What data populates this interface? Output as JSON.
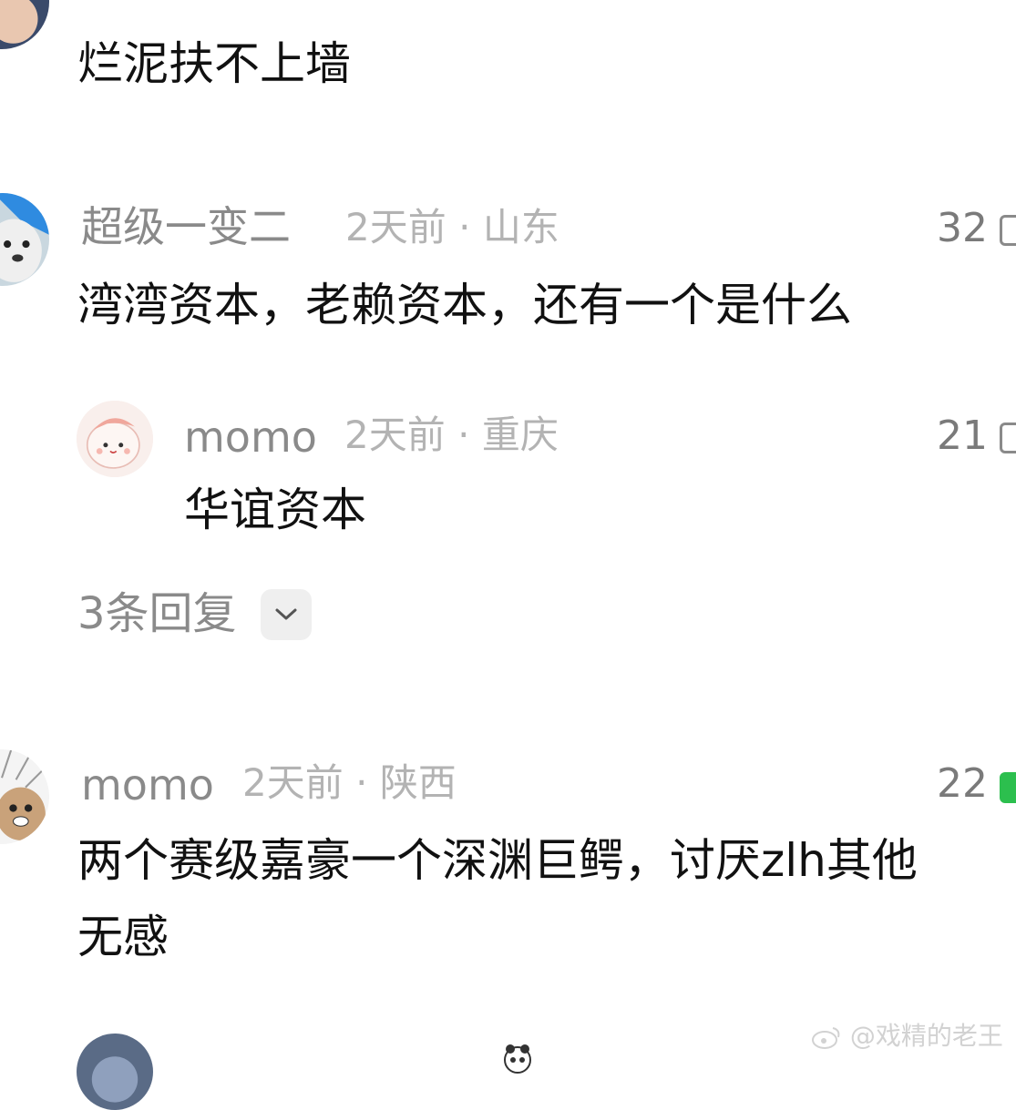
{
  "comments": [
    {
      "id": "c0",
      "username": "",
      "time": "",
      "location": "",
      "likes": "",
      "text": "烂泥扶不上墙"
    },
    {
      "id": "c1",
      "username": "超级一变二",
      "time": "2天前",
      "location": "山东",
      "likes": "32",
      "text": "湾湾资本，老赖资本，还有一个是什么",
      "reply": {
        "username": "momo",
        "time": "2天前",
        "location": "重庆",
        "likes": "21",
        "text": "华谊资本"
      },
      "more_replies_label": "3条回复"
    },
    {
      "id": "c2",
      "username": "momo",
      "time": "2天前",
      "location": "陕西",
      "likes": "22",
      "text_line1": "两个赛级嘉豪一个深渊巨鳄，讨厌zlh其他",
      "text_line2": "无感"
    }
  ],
  "separator": "·",
  "watermark": "@戏精的老王",
  "colors": {
    "username": "#8a8a8a",
    "meta": "#b3b3b3",
    "body_text": "#111111",
    "like_active": "#2cbf4e"
  }
}
